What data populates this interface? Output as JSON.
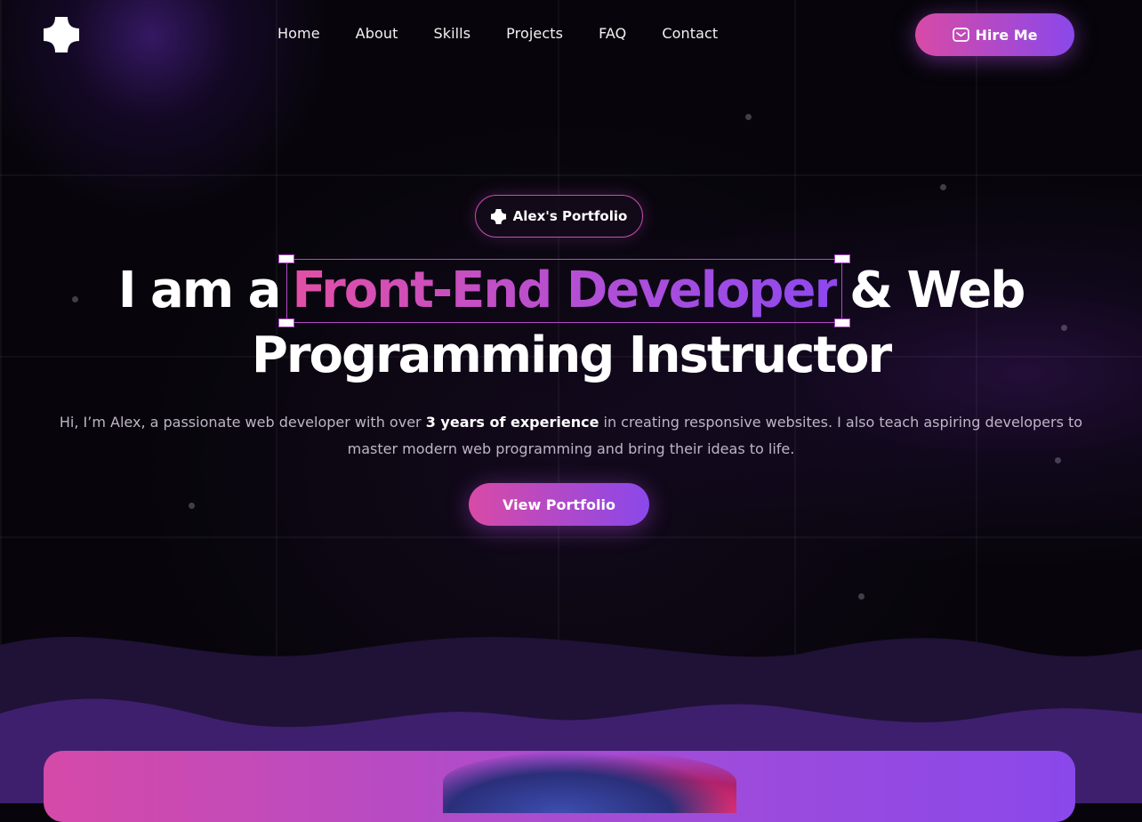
{
  "nav": {
    "items": [
      "Home",
      "About",
      "Skills",
      "Projects",
      "FAQ",
      "Contact"
    ],
    "hire_label": "Hire Me"
  },
  "hero": {
    "badge": "Alex's Portfolio",
    "headline_prefix": "I am a",
    "headline_highlight": "Front-End Developer",
    "headline_suffix": "& Web",
    "headline_line2": "Programming Instructor",
    "desc_before": "Hi, I’m Alex, a passionate web developer with over ",
    "desc_bold": "3 years of experience",
    "desc_after": " in creating responsive websites. I also teach aspiring developers to master modern web programming and bring their ideas to life.",
    "cta_label": "View Portfolio"
  },
  "colors": {
    "background": "#07050b",
    "gradient_start": "#d84aa6",
    "gradient_end": "#8a48ea",
    "wave_dark": "#1f1236",
    "wave_light": "#3e1f6e"
  },
  "icons": {
    "logo": "plus-cross-icon",
    "hire": "mail-icon",
    "badge": "plus-cross-icon"
  }
}
